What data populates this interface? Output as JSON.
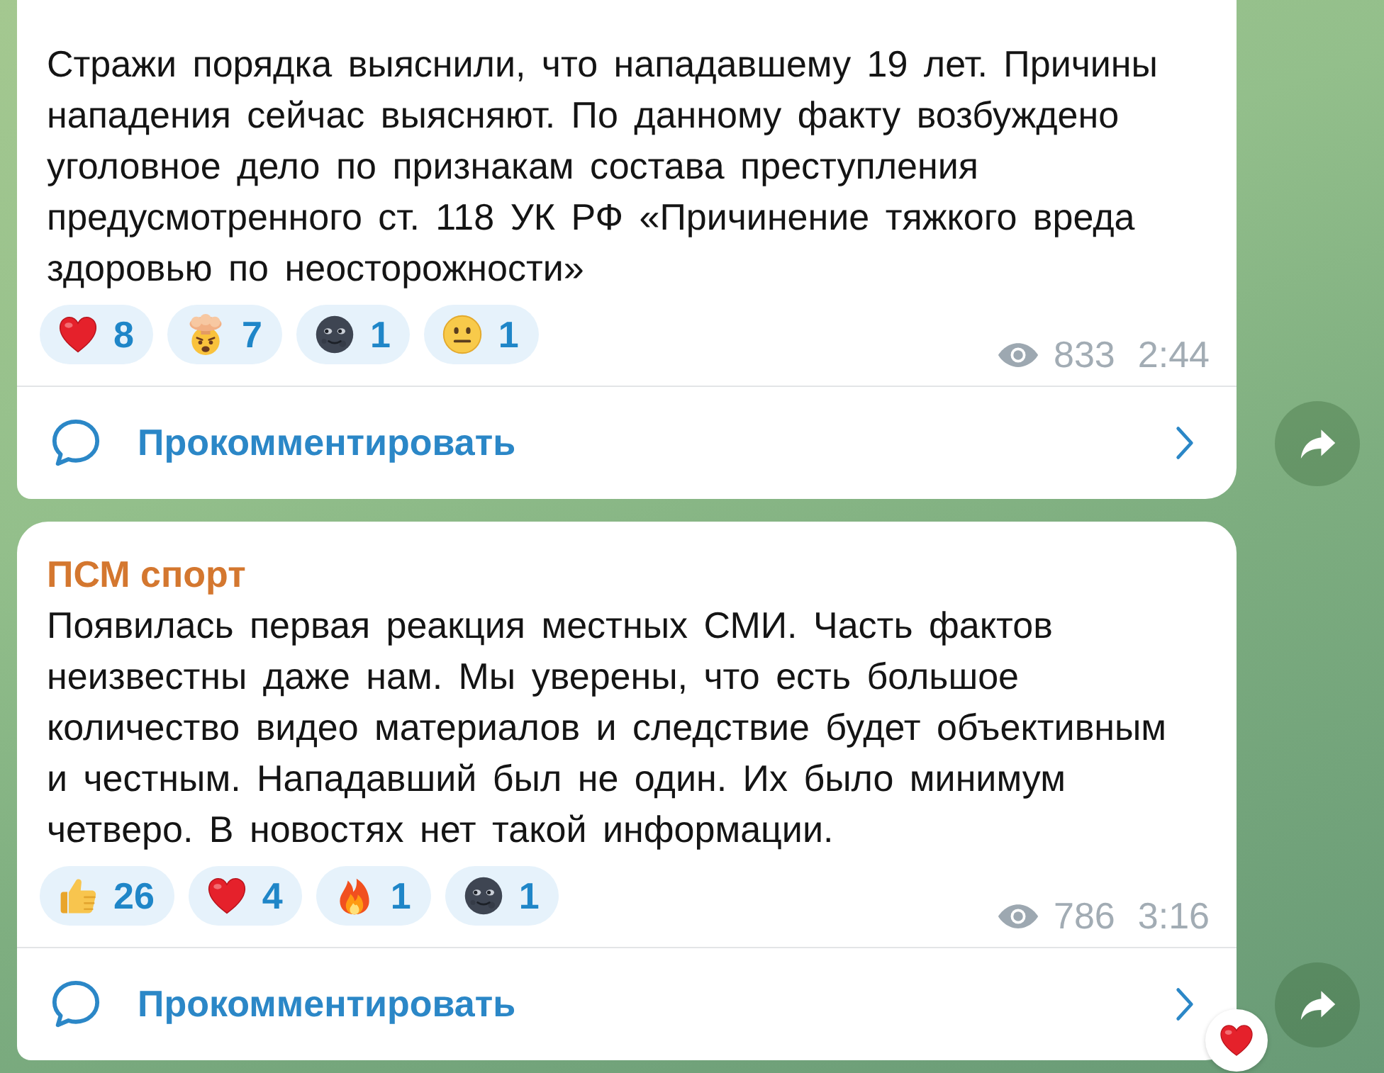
{
  "messages": [
    {
      "text": "Стражи порядка выяснили, что нападавшему 19 лет. Причины нападения сейчас выясняют. По данному факту возбуждено уголовное дело по признакам состава преступления предусмотренного ст. 118 УК РФ «Причинение тяжкого вреда здоровью по неосторожности»",
      "reactions": [
        {
          "kind": "heart",
          "count": "8",
          "selected": false
        },
        {
          "kind": "exploding-head",
          "count": "7",
          "selected": false
        },
        {
          "kind": "new-moon-face",
          "count": "1",
          "selected": false
        },
        {
          "kind": "neutral-face",
          "count": "1",
          "selected": false
        }
      ],
      "views": "833",
      "time": "2:44",
      "comments_label": "Прокомментировать"
    },
    {
      "author": "ПСМ спорт",
      "text": "Появилась первая реакция местных СМИ. Часть фактов неизвестны даже нам. Мы уверены, что есть большое количество видео материалов и следствие будет объективным и честным. Нападавший был не один. Их было минимум четверо. В новостях нет такой информации.",
      "reactions": [
        {
          "kind": "thumbs-up",
          "count": "26",
          "selected": false
        },
        {
          "kind": "heart",
          "count": "4",
          "selected": false
        },
        {
          "kind": "fire",
          "count": "1",
          "selected": false
        },
        {
          "kind": "new-moon-face",
          "count": "1",
          "selected": false
        }
      ],
      "views": "786",
      "time": "3:16",
      "comments_label": "Прокомментировать",
      "quick_reaction": {
        "kind": "heart"
      }
    }
  ]
}
